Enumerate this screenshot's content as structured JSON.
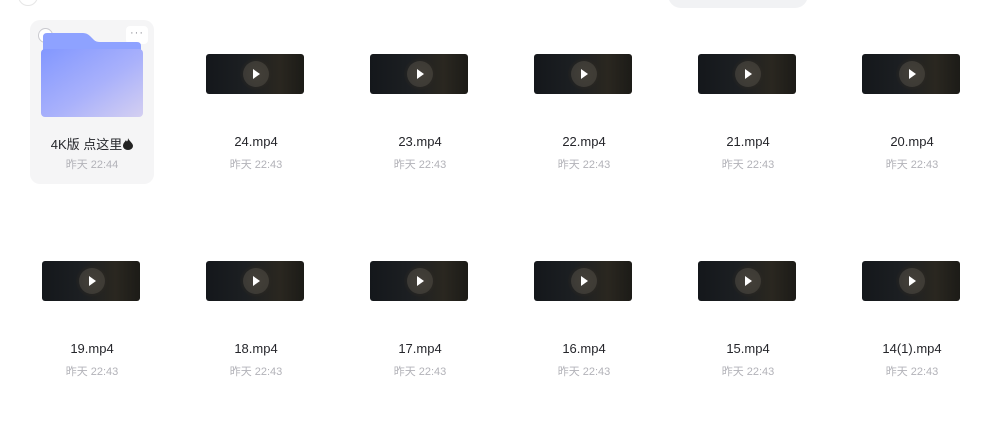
{
  "folder": {
    "name": "4K版 点这里",
    "time": "昨天 22:44",
    "more_label": "···",
    "icon": "folder-icon",
    "decoration_icon": "drop-icon",
    "colors": {
      "tile_bg": "#f5f5f6",
      "folder_back": "#8ea2ff",
      "folder_front_start": "#8297ff",
      "folder_front_end": "#c9c7f2"
    }
  },
  "files": [
    {
      "name": "24.mp4",
      "time": "昨天 22:43"
    },
    {
      "name": "23.mp4",
      "time": "昨天 22:43"
    },
    {
      "name": "22.mp4",
      "time": "昨天 22:43"
    },
    {
      "name": "21.mp4",
      "time": "昨天 22:43"
    },
    {
      "name": "20.mp4",
      "time": "昨天 22:43"
    },
    {
      "name": "19.mp4",
      "time": "昨天 22:43"
    },
    {
      "name": "18.mp4",
      "time": "昨天 22:43"
    },
    {
      "name": "17.mp4",
      "time": "昨天 22:43"
    },
    {
      "name": "16.mp4",
      "time": "昨天 22:43"
    },
    {
      "name": "15.mp4",
      "time": "昨天 22:43"
    },
    {
      "name": "14(1).mp4",
      "time": "昨天 22:43"
    }
  ],
  "file_icon": "play-icon"
}
